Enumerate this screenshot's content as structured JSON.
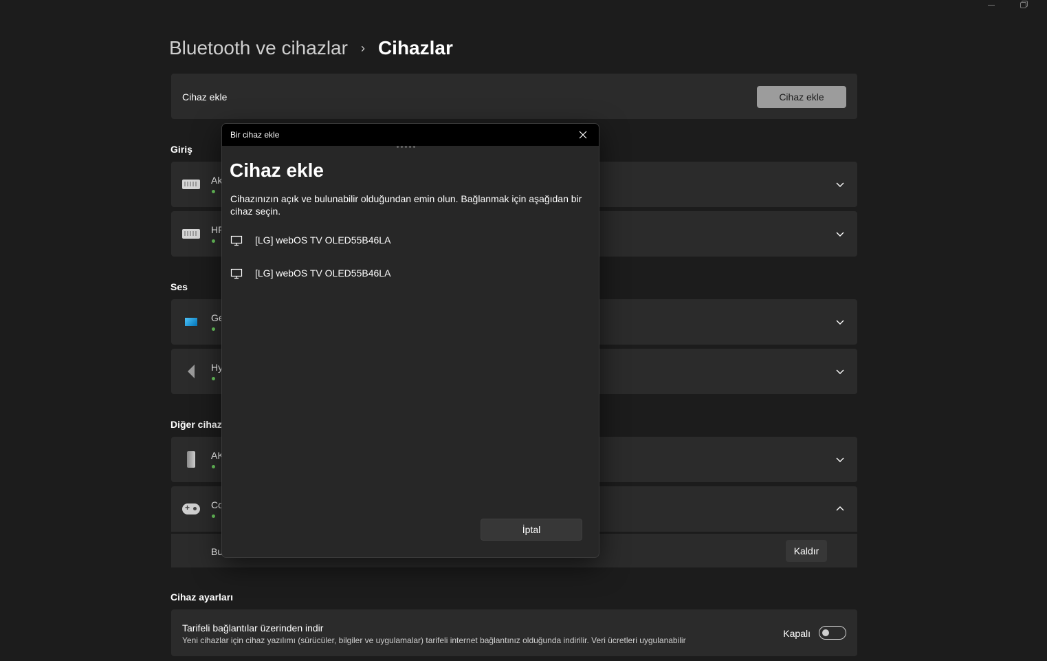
{
  "window": {
    "minimize_icon": "minimize-icon",
    "maximize_icon": "maximize-icon"
  },
  "breadcrumb": {
    "parent": "Bluetooth ve cihazlar",
    "separator": "›",
    "current": "Cihazlar"
  },
  "add_device": {
    "label": "Cihaz ekle",
    "button": "Cihaz ekle"
  },
  "sections": {
    "input": {
      "title": "Giriş",
      "devices": [
        {
          "name": "Ak",
          "icon": "keyboard-icon",
          "status": "connected"
        },
        {
          "name": "HP",
          "icon": "keyboard-icon",
          "status": "connected"
        }
      ]
    },
    "audio": {
      "title": "Ses",
      "devices": [
        {
          "name": "Ge",
          "icon": "monitor-icon",
          "status": "connected"
        },
        {
          "name": "Hy",
          "icon": "speaker-icon",
          "status": "connected"
        }
      ]
    },
    "other": {
      "title": "Diğer cihazl",
      "devices": [
        {
          "name": "AK",
          "icon": "pc-tower-icon",
          "status": "connected"
        },
        {
          "name": "Co",
          "icon": "gamepad-icon",
          "status": "connected",
          "expanded": true
        }
      ],
      "expanded_row": {
        "label": "Bu",
        "button": "Kaldır"
      }
    }
  },
  "device_settings": {
    "title": "Cihaz ayarları",
    "metered": {
      "title": "Tarifeli bağlantılar üzerinden indir",
      "description": "Yeni cihazlar için cihaz yazılımı (sürücüler, bilgiler ve uygulamalar) tarifeli internet bağlantınız olduğunda indirilir. Veri ücretleri uygulanabilir",
      "toggle_label": "Kapalı",
      "toggle_on": false
    }
  },
  "dialog": {
    "window_title": "Bir cihaz ekle",
    "heading": "Cihaz ekle",
    "description": "Cihazınızın açık ve bulunabilir olduğundan emin olun. Bağlanmak için aşağıdan bir cihaz seçin.",
    "devices": [
      {
        "name": "[LG] webOS TV OLED55B46LA",
        "icon": "display-icon"
      },
      {
        "name": "[LG] webOS TV OLED55B46LA",
        "icon": "display-icon"
      }
    ],
    "cancel": "İptal"
  },
  "colors": {
    "background": "#1c1c1c",
    "card": "#2b2b2b",
    "status_green": "#6ccb5f",
    "primary_button": "#9c9c9c"
  }
}
